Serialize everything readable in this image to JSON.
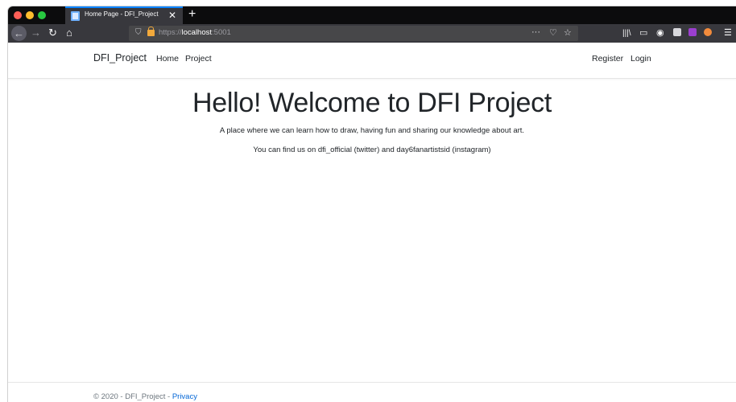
{
  "browser": {
    "tab_title": "Home Page - DFI_Project",
    "tab_close": "✕",
    "new_tab": "+",
    "url_prefix": "https://",
    "url_host": "localhost",
    "url_port": ":5001",
    "more_menu": "···",
    "colors": {
      "tab_strip": "#0c0c0d",
      "toolbar": "#38383d",
      "active_tab_accent": "#0a84ff",
      "lock_warning": "#f2a93b"
    }
  },
  "site": {
    "brand": "DFI_Project",
    "nav_left": [
      "Home",
      "Project"
    ],
    "nav_right": [
      "Register",
      "Login"
    ]
  },
  "hero": {
    "title": "Hello! Welcome to DFI Project",
    "line1": "A place where we can learn how to draw, having fun and sharing our knowledge about art.",
    "line2": "You can find us on dfi_official (twitter) and day6fanartistsid (instagram)"
  },
  "footer": {
    "copyright": "© 2020 - DFI_Project - ",
    "privacy_link": "Privacy",
    "link_color": "#0366d6"
  }
}
